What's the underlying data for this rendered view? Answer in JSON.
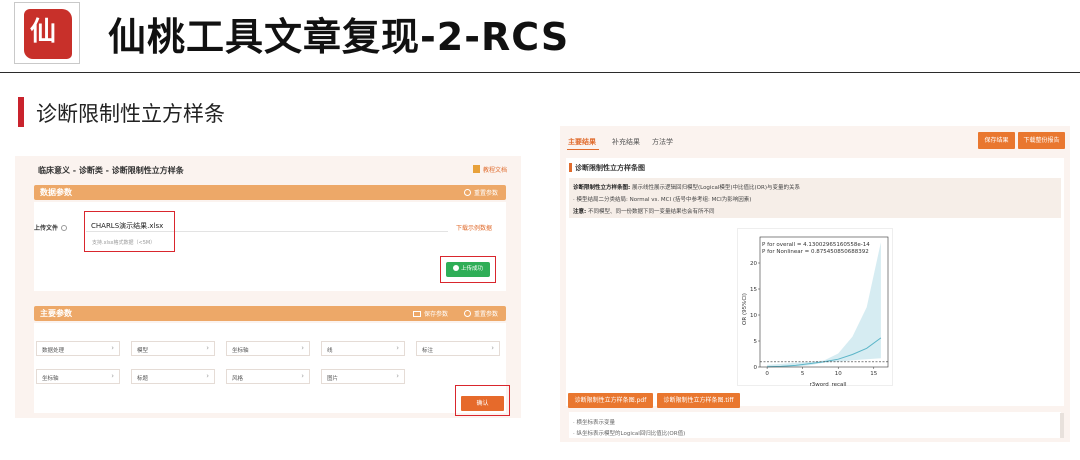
{
  "header": {
    "logo_text": "仙",
    "title": "仙桃工具文章复现-2-RCS",
    "section_title": "诊断限制性立方样条"
  },
  "left_panel": {
    "breadcrumb": "临床意义 - 诊断类 - 诊断限制性立方样条",
    "doc_link": "教程文档",
    "data_section": {
      "title": "数据参数",
      "reset": "重置参数",
      "upload_label": "上传文件",
      "file_name": "CHARLS演示结果.xlsx",
      "file_hint": "支持.xlsx格式数据（<5M）",
      "download_example": "下载示例数据",
      "upload_success": "上传成功"
    },
    "main_section": {
      "title": "主要参数",
      "save": "保存参数",
      "reset": "重置参数",
      "selects_row1": [
        "数据处理",
        "模型",
        "坐标轴",
        "线",
        "标注"
      ],
      "selects_row2": [
        "坐标轴",
        "标题",
        "风格",
        "图片"
      ],
      "confirm": "确认"
    }
  },
  "right_panel": {
    "tabs": [
      "主要结果",
      "补充结果",
      "方法学"
    ],
    "save_result": "保存结果",
    "download_report": "下载整份报告",
    "chart_heading": "诊断限制性立方样条图",
    "desc_label": "诊断限制性立方样条图:",
    "desc_text": "展示线性展示逻辑回归模型(Logical模型)中比值比(OR)与变量的关系",
    "desc_line2": "· 模型结局二分类结局: Normal vs. MCI (括号中参考组: MCI为影响因素)",
    "note_label": "注意:",
    "note_text": "不同模型、同一份数据下同一变量结果也会有所不同",
    "download_pdf": "诊断限制性立方样条图.pdf",
    "download_tiff": "诊断限制性立方样条图.tiff",
    "notes": [
      "· 横坐标表示变量",
      "· 纵坐标表示模型的Logical回归比值比(OR值)"
    ]
  },
  "chart_data": {
    "type": "line",
    "xlabel": "r3word_recall",
    "ylabel": "OR (95%CI)",
    "annotations": [
      "P for overall = 4.13002965160558e-14",
      "P for Nonlinear = 0.875450850688392"
    ],
    "xlim": [
      -1,
      17
    ],
    "ylim": [
      0,
      25
    ],
    "xticks": [
      0,
      5,
      10,
      15
    ],
    "yticks": [
      0,
      5,
      10,
      15,
      20
    ],
    "reference_y": 1,
    "series": [
      {
        "x": [
          0,
          2,
          4,
          6,
          8,
          10,
          12,
          14,
          16
        ],
        "y": [
          0.05,
          0.12,
          0.3,
          0.65,
          1.0,
          1.5,
          2.4,
          3.6,
          5.6
        ],
        "lower": [
          0.0,
          0.0,
          0.05,
          0.35,
          0.85,
          1.0,
          1.3,
          1.5,
          1.7
        ],
        "upper": [
          0.4,
          0.6,
          0.8,
          1.0,
          1.25,
          2.6,
          5.8,
          11.5,
          24.0
        ]
      }
    ],
    "colors": {
      "line": "#5bb5c8",
      "band": "#d6ecf2",
      "ref": "#333333"
    }
  }
}
